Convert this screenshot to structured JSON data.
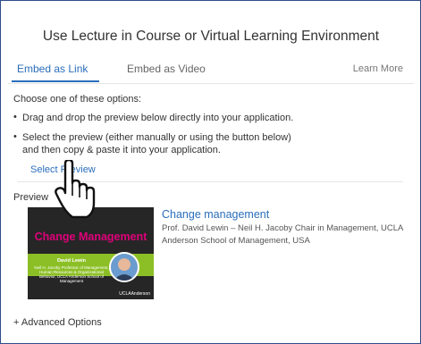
{
  "dialog": {
    "title": "Use Lecture in Course or Virtual Learning Environment"
  },
  "tabs": {
    "items": [
      {
        "label": "Embed as Link",
        "active": true
      },
      {
        "label": "Embed as Video",
        "active": false
      }
    ],
    "learn_more": "Learn More"
  },
  "instructions": {
    "intro": "Choose one of these options:",
    "bullet_char": "•",
    "option1": "Drag and drop the preview below directly into your application.",
    "option2_line1": "Select the preview (either manually or using the button below)",
    "option2_line2": "and then copy & paste it into your application.",
    "select_preview_link": "Select Preview"
  },
  "preview": {
    "label": "Preview",
    "thumbnail": {
      "title": "Change Management",
      "presenter": "David Lewin",
      "presenter_titles": "Neil H. Jacoby Professor of Management, Human Resources & Organizational Behavior, UCLA Anderson School of Management",
      "logo": "UCLAAnderson"
    },
    "course_title": "Change management",
    "course_subtitle": "Prof. David Lewin – Neil H. Jacoby Chair in Management, UCLA Anderson School of Management, USA"
  },
  "advanced": {
    "label": "+ Advanced Options"
  },
  "colors": {
    "accent": "#2a6ebb",
    "thumb_title": "#e0007a",
    "thumb_band": "#8cbf26",
    "frame_border": "#2f4d8a"
  },
  "icons": {
    "cursor": "hand-pointer-icon"
  }
}
